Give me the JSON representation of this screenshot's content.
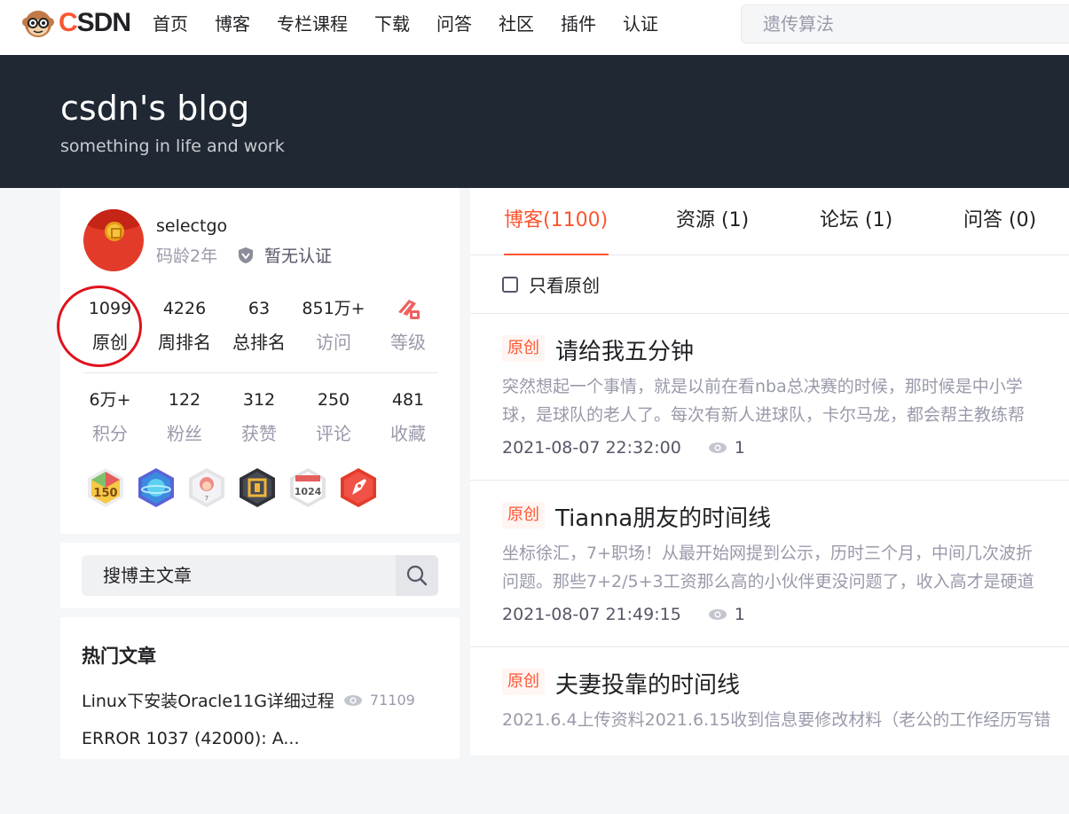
{
  "header": {
    "logo_text_a": "C",
    "logo_text_b": "SDN",
    "nav": [
      "首页",
      "博客",
      "专栏课程",
      "下载",
      "问答",
      "社区",
      "插件",
      "认证"
    ],
    "search_value": "遗传算法"
  },
  "banner": {
    "title": "csdn's blog",
    "subtitle": "something in life and work"
  },
  "profile": {
    "username": "selectgo",
    "code_age": "码龄2年",
    "certification": "暂无认证",
    "stats_row1": [
      {
        "num": "1099",
        "label": "原创"
      },
      {
        "num": "4226",
        "label": "周排名"
      },
      {
        "num": "63",
        "label": "总排名"
      },
      {
        "num": "851万+",
        "label": "访问"
      },
      {
        "num": "",
        "label": "等级"
      }
    ],
    "stats_row2": [
      {
        "num": "6万+",
        "label": "积分"
      },
      {
        "num": "122",
        "label": "粉丝"
      },
      {
        "num": "312",
        "label": "获赞"
      },
      {
        "num": "250",
        "label": "评论"
      },
      {
        "num": "481",
        "label": "收藏"
      }
    ],
    "badges": [
      {
        "icon": "badge-150-icon",
        "text": "150",
        "color": "#f3b43a"
      },
      {
        "icon": "badge-planet-icon",
        "text": "",
        "color": "#4b6fe0"
      },
      {
        "icon": "badge-monkey-icon",
        "text": "",
        "color": "#e9e9ec"
      },
      {
        "icon": "badge-column-icon",
        "text": "",
        "color": "#3b3f47"
      },
      {
        "icon": "badge-1024-icon",
        "text": "1024",
        "color": "#d9d9dd"
      },
      {
        "icon": "badge-pen-icon",
        "text": "",
        "color": "#e33b2a"
      }
    ]
  },
  "sidebar_search": {
    "placeholder": "搜博主文章"
  },
  "hot_articles": {
    "title": "热门文章",
    "items": [
      {
        "title": "Linux下安装Oracle11G详细过程",
        "views": "71109"
      },
      {
        "title": "ERROR 1037 (42000): A...",
        "views": ""
      }
    ]
  },
  "tabs": [
    {
      "label": "博客(1100)",
      "active": true
    },
    {
      "label": "资源 (1)",
      "active": false
    },
    {
      "label": "论坛 (1)",
      "active": false
    },
    {
      "label": "问答 (0)",
      "active": false
    }
  ],
  "filter": {
    "label": "只看原创"
  },
  "articles": [
    {
      "tag": "原创",
      "title": "请给我五分钟",
      "desc1": "突然想起一个事情，就是以前在看nba总决赛的时候，那时候是中小学",
      "desc2": "球，是球队的老人了。每次有新人进球队，卡尔马龙，都会帮主教练帮",
      "date": "2021-08-07 22:32:00",
      "views": "1"
    },
    {
      "tag": "原创",
      "title": "Tianna朋友的时间线",
      "desc1": "坐标徐汇，7+职场！从最开始网提到公示，历时三个月，中间几次波折",
      "desc2": "问题。那些7+2/5+3工资那么高的小伙伴更没问题了，收入高才是硬道",
      "date": "2021-08-07 21:49:15",
      "views": "1"
    },
    {
      "tag": "原创",
      "title": "夫妻投靠的时间线",
      "desc1": "2021.6.4上传资料2021.6.15收到信息要修改材料（老公的工作经历写错",
      "desc2": "",
      "date": "",
      "views": ""
    }
  ],
  "colors": {
    "accent": "#fc5531",
    "banner_bg": "#202834",
    "highlight_circle": "#e0121d"
  }
}
